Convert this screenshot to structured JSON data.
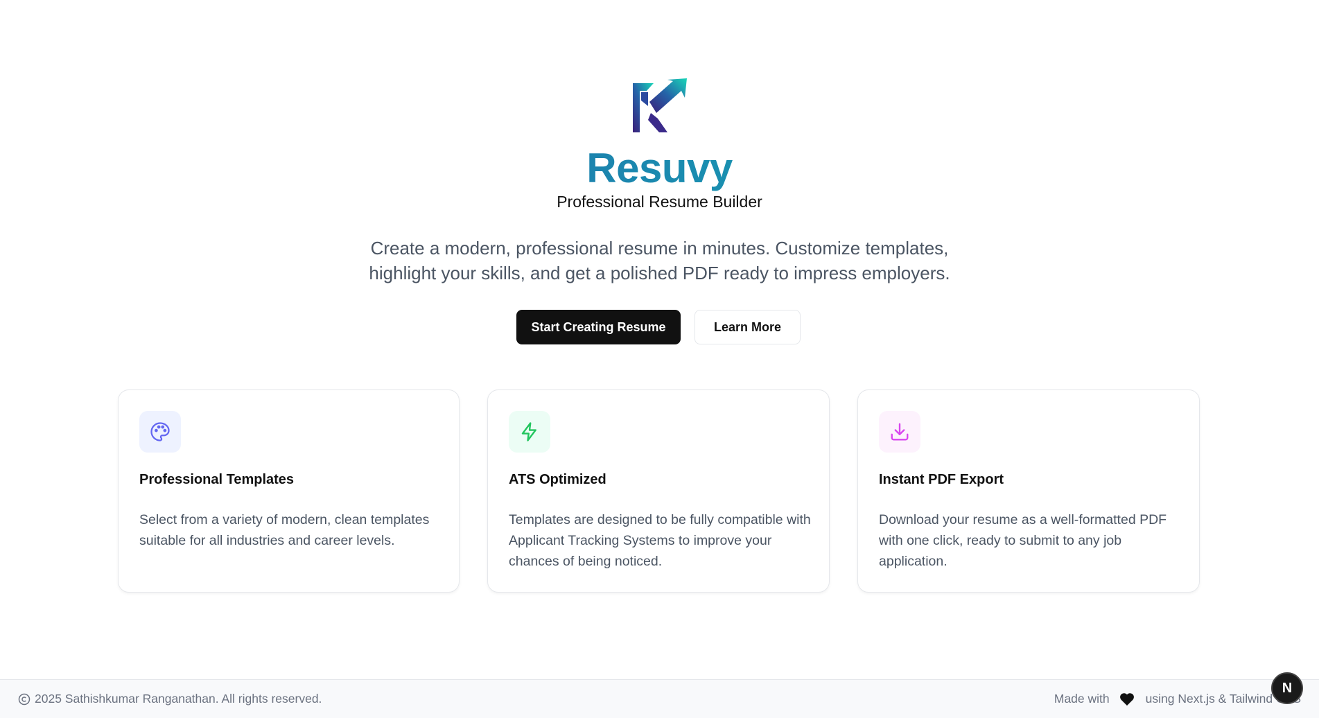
{
  "brand": {
    "logo_icon": "resuvy-logo-icon",
    "name": "Resuvy",
    "tagline": "Professional Resume Builder"
  },
  "hero": {
    "intro": "Create a modern, professional resume in minutes. Customize templates, highlight your skills, and get a polished PDF ready to impress employers."
  },
  "actions": {
    "primary_label": "Start Creating Resume",
    "secondary_label": "Learn More"
  },
  "features": [
    {
      "icon": "palette-icon",
      "accent": "#6366f1",
      "bg": "#eef2ff",
      "title": "Professional Templates",
      "description": "Select from a variety of modern, clean templates suitable for all industries and career levels."
    },
    {
      "icon": "lightning-icon",
      "accent": "#22c55e",
      "bg": "#ecfdf5",
      "title": "ATS Optimized",
      "description": "Templates are designed to be fully compatible with Applicant Tracking Systems to improve your chances of being noticed."
    },
    {
      "icon": "download-icon",
      "accent": "#d946ef",
      "bg": "#fdf2fd",
      "title": "Instant PDF Export",
      "description": "Download your resume as a well-formatted PDF with one click, ready to submit to any job application."
    }
  ],
  "footer": {
    "copyright": "2025 Sathishkumar Ranganathan. All rights reserved.",
    "made_with": "Made with",
    "tech": "using Next.js & Tailwind CSS"
  },
  "dev_badge": {
    "letter": "N"
  },
  "colors": {
    "primary_button": "#111111",
    "brand_gradient_start": "#2453a6",
    "brand_gradient_end": "#11c6a6"
  }
}
